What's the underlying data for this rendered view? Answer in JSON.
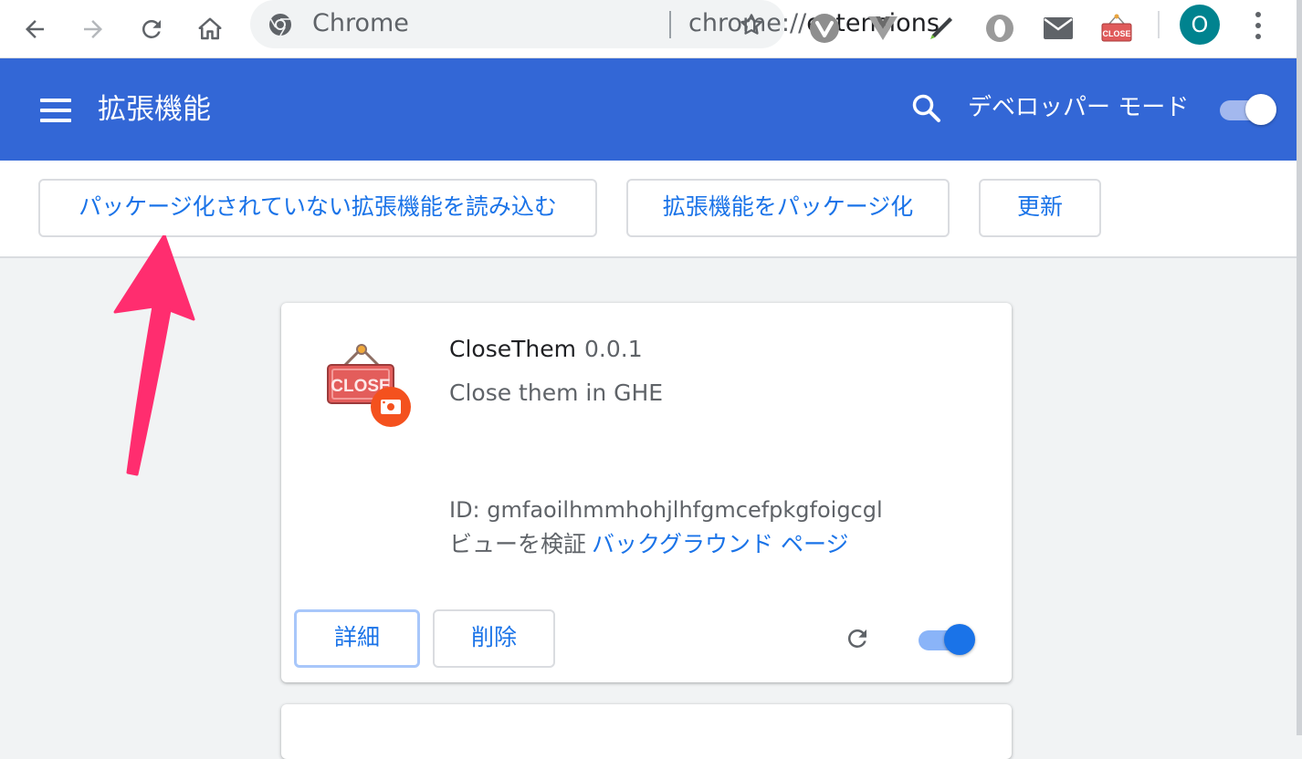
{
  "browser": {
    "omnibox": {
      "site_label": "Chrome",
      "url_prefix": "chrome://",
      "url_path": "extensions"
    },
    "toolbar_extension_icons": [
      "vivaldi-icon",
      "vue-devtools-icon",
      "pen-extension-icon",
      "opera-icon",
      "mail-icon",
      "closethem-icon"
    ],
    "closethem_badge_text": "CLOSE",
    "profile_initial": "O"
  },
  "header": {
    "title": "拡張機能",
    "developer_mode_label": "デベロッパー モード",
    "developer_mode_on": true
  },
  "actions": {
    "load_unpacked": "パッケージ化されていない拡張機能を読み込む",
    "pack_extension": "拡張機能をパッケージ化",
    "update": "更新"
  },
  "extensions": [
    {
      "name": "CloseThem",
      "version": "0.0.1",
      "description": "Close them in GHE",
      "id": "ID: gmfaoilhmmhohjlhfgmcefpkgfoigcgl",
      "inspect_label": "ビューを検証",
      "inspect_link": "バックグラウンド ページ",
      "logo_text": "CLOSE",
      "details_label": "詳細",
      "remove_label": "削除",
      "enabled": true
    }
  ],
  "colors": {
    "header_blue": "#3367d6",
    "link_blue": "#1a73e8",
    "annotation_arrow": "#ff2d6f"
  }
}
